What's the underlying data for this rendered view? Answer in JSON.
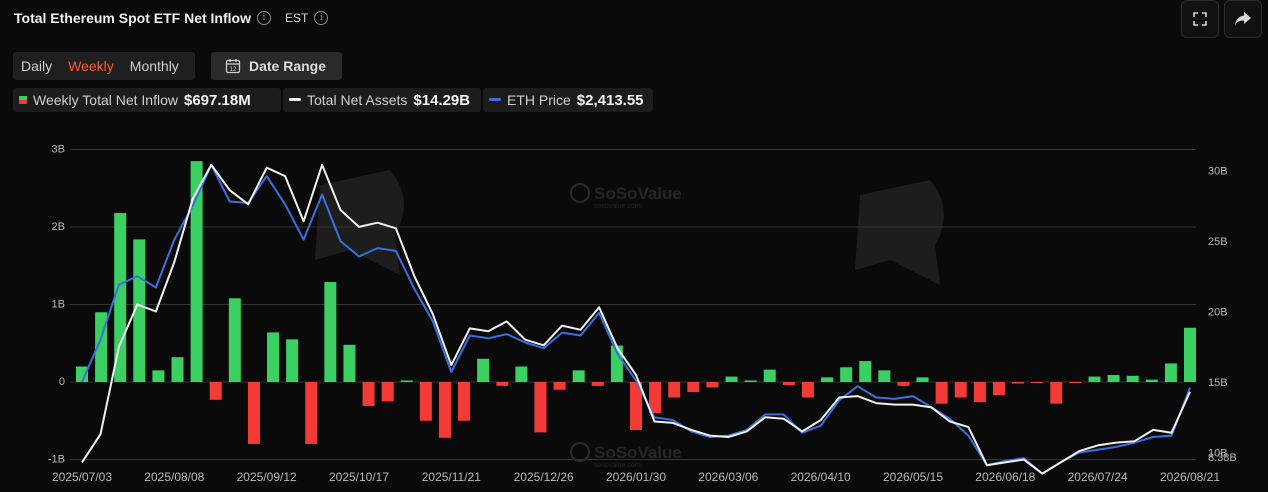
{
  "header": {
    "title": "Total Ethereum Spot ETF Net Inflow",
    "timezone": "EST"
  },
  "tabs": [
    {
      "label": "Daily"
    },
    {
      "label": "Weekly"
    },
    {
      "label": "Monthly"
    }
  ],
  "date_range": {
    "label": "Date Range"
  },
  "legend": [
    {
      "name": "Weekly Total Net Inflow",
      "value": "$697.18M"
    },
    {
      "name": "Total Net Assets",
      "value": "$14.29B"
    },
    {
      "name": "ETH Price",
      "value": "$2,413.55"
    }
  ],
  "watermark": {
    "text": "SoSoValue",
    "sub": "sosovalue.com"
  },
  "colors": {
    "positive": "#3ad062",
    "negative": "#f23b37",
    "assets_line": "#f0f0f0",
    "price_line": "#3b6fe0",
    "accent": "#ff5a2a"
  },
  "chart_data": {
    "type": "bar",
    "x_ticks": [
      "2025/07/03",
      "2025/08/08",
      "2025/09/12",
      "2025/10/17",
      "2025/11/21",
      "2025/12/26",
      "2026/01/30",
      "2026/03/06",
      "2026/04/10",
      "2026/05/15",
      "2026/06/18",
      "2026/07/24",
      "2026/08/21"
    ],
    "left_axis": {
      "ticks": [
        "3B",
        "2B",
        "1B",
        "0",
        "-1B"
      ],
      "ylim": [
        -1,
        3
      ],
      "unit": "B"
    },
    "right_axis": {
      "ticks": [
        "30B",
        "25B",
        "20B",
        "15B",
        "10B",
        "8.38B"
      ],
      "ylim": [
        8.38,
        30
      ],
      "unit": "B"
    },
    "series": [
      {
        "name": "Weekly Total Net Inflow",
        "type": "bar",
        "values": [
          0.2,
          0.9,
          2.18,
          1.84,
          0.15,
          0.32,
          2.85,
          -0.23,
          1.08,
          -0.8,
          0.64,
          0.55,
          -0.8,
          1.29,
          0.48,
          -0.31,
          -0.25,
          0.02,
          -0.5,
          -0.72,
          -0.5,
          0.3,
          -0.05,
          0.2,
          -0.65,
          -0.1,
          0.15,
          -0.05,
          0.47,
          -0.62,
          -0.4,
          -0.2,
          -0.13,
          -0.07,
          0.07,
          0.02,
          0.16,
          -0.04,
          -0.2,
          0.06,
          0.19,
          0.27,
          0.15,
          -0.05,
          0.06,
          -0.28,
          -0.2,
          -0.26,
          -0.17,
          -0.02,
          -0.01,
          -0.28,
          -0.01,
          0.07,
          0.09,
          0.08,
          0.03,
          0.24,
          0.7
        ]
      },
      {
        "name": "Total Net Assets",
        "type": "line",
        "values": [
          9.3,
          11.3,
          17.5,
          20.5,
          20,
          23.5,
          28,
          30.4,
          28.6,
          27.6,
          30.2,
          29.6,
          26.4,
          30.4,
          27.2,
          26,
          26.3,
          25.9,
          22.5,
          19.8,
          16.2,
          18.8,
          18.6,
          19.3,
          18,
          17.6,
          19,
          18.7,
          20.3,
          17.4,
          15.5,
          12.2,
          12.1,
          11.6,
          11.2,
          11.1,
          11.5,
          12.5,
          12.4,
          11.5,
          12.3,
          13.9,
          14,
          13.5,
          13.4,
          13.4,
          13.2,
          12.2,
          11.8,
          9.1,
          9.3,
          9.5,
          8.5,
          9.3,
          10.1,
          10.5,
          10.7,
          10.8,
          11.6,
          11.4,
          14.3
        ]
      },
      {
        "name": "ETH Price",
        "type": "line",
        "values": [
          15,
          18,
          21.9,
          22.5,
          21.7,
          25.1,
          27.5,
          30.4,
          27.8,
          27.7,
          29.6,
          27.6,
          25.1,
          28.3,
          25,
          23.9,
          24.5,
          24.3,
          21.6,
          19.3,
          15.7,
          18.3,
          18.1,
          18.4,
          17.8,
          17.4,
          18.5,
          18.3,
          19.9,
          17,
          15.1,
          12.5,
          12.3,
          11.5,
          11.1,
          11.2,
          11.6,
          12.7,
          12.7,
          11.4,
          11.9,
          13.7,
          14.7,
          13.9,
          13.8,
          14,
          13.2,
          12.4,
          11.2,
          9.1,
          9.4,
          9.6,
          8.5,
          9.3,
          10,
          10.2,
          10.4,
          10.7,
          11.1,
          11.2,
          14.6
        ]
      }
    ]
  }
}
